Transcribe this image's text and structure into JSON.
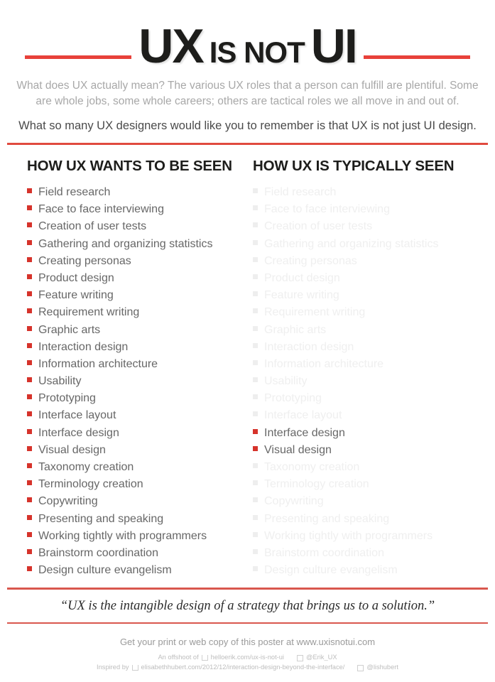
{
  "header": {
    "title_part1": "UX",
    "title_part2": "IS NOT",
    "title_part3": "UI",
    "lede": "What does UX actually mean? The various UX roles that a person can fulfill are plentiful. Some are whole jobs, some whole careers; others are tactical roles we all move in and out of.",
    "lede_strong": "What so many UX designers would like you to remember is that UX is not just UI design."
  },
  "columns": [
    {
      "heading": "HOW UX WANTS TO BE SEEN",
      "items": [
        {
          "label": "Field research",
          "highlighted": true
        },
        {
          "label": "Face to face interviewing",
          "highlighted": true
        },
        {
          "label": "Creation of user tests",
          "highlighted": true
        },
        {
          "label": "Gathering and organizing statistics",
          "highlighted": true
        },
        {
          "label": "Creating personas",
          "highlighted": true
        },
        {
          "label": "Product design",
          "highlighted": true
        },
        {
          "label": "Feature writing",
          "highlighted": true
        },
        {
          "label": "Requirement writing",
          "highlighted": true
        },
        {
          "label": "Graphic arts",
          "highlighted": true
        },
        {
          "label": "Interaction design",
          "highlighted": true
        },
        {
          "label": "Information architecture",
          "highlighted": true
        },
        {
          "label": "Usability",
          "highlighted": true
        },
        {
          "label": "Prototyping",
          "highlighted": true
        },
        {
          "label": "Interface layout",
          "highlighted": true
        },
        {
          "label": "Interface design",
          "highlighted": true
        },
        {
          "label": "Visual design",
          "highlighted": true
        },
        {
          "label": "Taxonomy creation",
          "highlighted": true
        },
        {
          "label": "Terminology creation",
          "highlighted": true
        },
        {
          "label": "Copywriting",
          "highlighted": true
        },
        {
          "label": "Presenting and speaking",
          "highlighted": true
        },
        {
          "label": "Working tightly with programmers",
          "highlighted": true
        },
        {
          "label": "Brainstorm coordination",
          "highlighted": true
        },
        {
          "label": "Design culture evangelism",
          "highlighted": true
        }
      ]
    },
    {
      "heading": "HOW UX IS TYPICALLY SEEN",
      "items": [
        {
          "label": "Field research",
          "highlighted": false
        },
        {
          "label": "Face to face interviewing",
          "highlighted": false
        },
        {
          "label": "Creation of user tests",
          "highlighted": false
        },
        {
          "label": "Gathering and organizing statistics",
          "highlighted": false
        },
        {
          "label": "Creating personas",
          "highlighted": false
        },
        {
          "label": "Product design",
          "highlighted": false
        },
        {
          "label": "Feature writing",
          "highlighted": false
        },
        {
          "label": "Requirement writing",
          "highlighted": false
        },
        {
          "label": "Graphic arts",
          "highlighted": false
        },
        {
          "label": "Interaction design",
          "highlighted": false
        },
        {
          "label": "Information architecture",
          "highlighted": false
        },
        {
          "label": "Usability",
          "highlighted": false
        },
        {
          "label": "Prototyping",
          "highlighted": false
        },
        {
          "label": "Interface layout",
          "highlighted": false
        },
        {
          "label": "Interface design",
          "highlighted": true
        },
        {
          "label": "Visual design",
          "highlighted": true
        },
        {
          "label": "Taxonomy creation",
          "highlighted": false
        },
        {
          "label": "Terminology creation",
          "highlighted": false
        },
        {
          "label": "Copywriting",
          "highlighted": false
        },
        {
          "label": "Presenting and speaking",
          "highlighted": false
        },
        {
          "label": "Working tightly with programmers",
          "highlighted": false
        },
        {
          "label": "Brainstorm coordination",
          "highlighted": false
        },
        {
          "label": "Design culture evangelism",
          "highlighted": false
        }
      ]
    }
  ],
  "quote": "“UX is the intangible design of a strategy that brings us to a solution.”",
  "footer": {
    "main": "Get your print or web copy of this poster at www.uxisnotui.com",
    "credit1_prefix": "An offshoot of",
    "credit1_link": "helloerik.com/ux-is-not-ui",
    "credit1_handle": "@Erik_UX",
    "credit2_prefix": "Inspired by",
    "credit2_link": "elisabethhubert.com/2012/12/interaction-design-beyond-the-interface/",
    "credit2_handle": "@lishubert"
  },
  "colors": {
    "accent_red": "#d6332b",
    "rule_red": "#e04a3f",
    "faded_grey": "#efefef",
    "body_grey": "#676767",
    "heading_black": "#1d1d1b"
  }
}
